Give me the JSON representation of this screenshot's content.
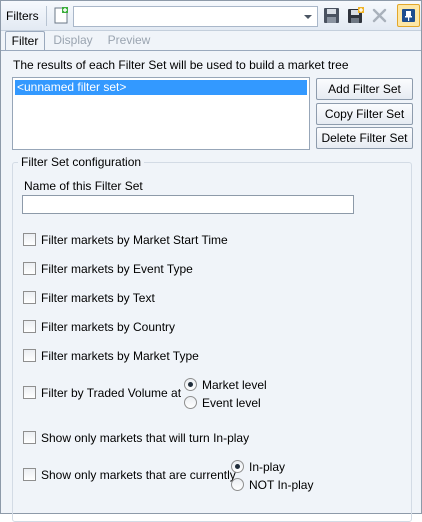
{
  "toolbar": {
    "title": "Filters",
    "combo_value": "",
    "icons": [
      "new-filter-icon",
      "dropdown-arrow-icon",
      "save-icon",
      "save-as-icon",
      "delete-icon",
      "pin-icon"
    ]
  },
  "tabs": [
    {
      "label": "Filter",
      "active": true
    },
    {
      "label": "Display",
      "active": false
    },
    {
      "label": "Preview",
      "active": false
    }
  ],
  "filter_sets": {
    "intro": "The results of each Filter Set will be used to build a market tree",
    "items": [
      "<unnamed filter set>"
    ],
    "buttons": {
      "add": "Add Filter Set",
      "copy": "Copy Filter Set",
      "delete": "Delete Filter Set"
    }
  },
  "config": {
    "legend": "Filter Set configuration",
    "name_label": "Name of this Filter Set",
    "name_value": "",
    "checks": {
      "start_time": "Filter markets by Market Start Time",
      "event_type": "Filter markets by Event Type",
      "text": "Filter markets by Text",
      "country": "Filter markets by Country",
      "market_type": "Filter markets by Market Type",
      "traded_volume": "Filter by Traded Volume at",
      "inplay": "Show only markets that will turn In-play",
      "currently": "Show only markets that are currently"
    },
    "volume_radios": {
      "market": "Market level",
      "event": "Event level"
    },
    "current_radios": {
      "inplay": "In-play",
      "not_inplay": "NOT In-play"
    }
  },
  "colors": {
    "selection": "#3399ff",
    "pin_button": "#fde7a6"
  }
}
